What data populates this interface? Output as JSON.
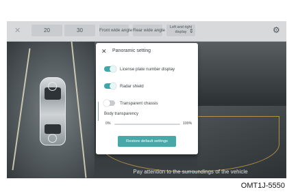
{
  "topbar": {
    "close_icon": "close-x-icon",
    "value_a": "20",
    "value_b": "30",
    "front_wide_angle": "Front wide angle",
    "rear_wide_angle": "Rear wide angle",
    "left_right_display_line1": "Left and right",
    "left_right_display_line2": "display",
    "expand_icon": "chevron-up-down-icon",
    "settings_icon": "gear-icon"
  },
  "dialog": {
    "close_icon": "close-x-icon",
    "title": "Panoramic setting",
    "options": [
      {
        "label": "License plate number display",
        "enabled": true
      },
      {
        "label": "Radar shield",
        "enabled": true
      },
      {
        "label": "Transparent chassis",
        "enabled": false
      }
    ],
    "body_transparency": {
      "label": "Body transparency",
      "min_label": "0%",
      "max_label": "100%",
      "value_fraction": 0
    },
    "restore_button": "Restore default settings"
  },
  "camera": {
    "notice": "Pay attention to the surroundings of the vehicle"
  },
  "figure_code": "OMT1J-5550",
  "colors": {
    "accent": "#3fa7a9",
    "button": "#46a9a8"
  }
}
